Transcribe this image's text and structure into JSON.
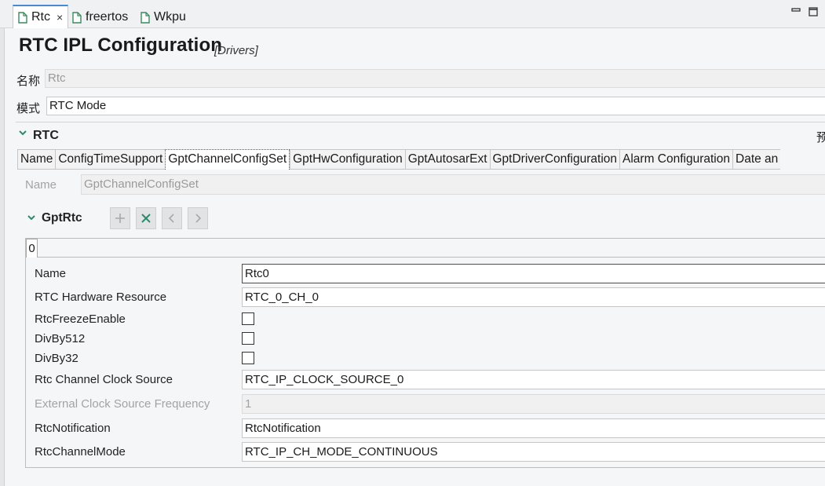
{
  "editor_tabs": [
    {
      "label": "Rtc",
      "close": "×"
    },
    {
      "label": "freertos"
    },
    {
      "label": "Wkpu"
    }
  ],
  "header": {
    "title": "RTC IPL Configuration",
    "subtitle": "[Drivers]"
  },
  "fields": {
    "name_label": "名称",
    "name_value": "Rtc",
    "mode_label": "模式",
    "mode_value": "RTC Mode"
  },
  "section": {
    "title": "RTC",
    "right_text": "预"
  },
  "tabs": [
    {
      "label": "Name"
    },
    {
      "label": "ConfigTimeSupport"
    },
    {
      "label": "GptChannelConfigSet"
    },
    {
      "label": "GptHwConfiguration"
    },
    {
      "label": "GptAutosarExt"
    },
    {
      "label": "GptDriverConfiguration"
    },
    {
      "label": "Alarm Configuration"
    },
    {
      "label": "Date an"
    }
  ],
  "channel_set": {
    "name_label": "Name",
    "name_value": "GptChannelConfigSet"
  },
  "subsection": {
    "title": "GptRtc",
    "index_tab": "0"
  },
  "properties": {
    "name": {
      "label": "Name",
      "value": "Rtc0"
    },
    "hw_resource": {
      "label": "RTC Hardware Resource",
      "value": "RTC_0_CH_0"
    },
    "freeze": {
      "label": "RtcFreezeEnable"
    },
    "div512": {
      "label": "DivBy512"
    },
    "div32": {
      "label": "DivBy32"
    },
    "clock_source": {
      "label": "Rtc Channel Clock Source",
      "value": "RTC_IP_CLOCK_SOURCE_0"
    },
    "ext_freq": {
      "label": "External Clock Source Frequency",
      "value": "1"
    },
    "notification": {
      "label": "RtcNotification",
      "value": "RtcNotification"
    },
    "channel_mode": {
      "label": "RtcChannelMode",
      "value": "RTC_IP_CH_MODE_CONTINUOUS"
    }
  },
  "colors": {
    "accent_green": "#2d8a6e",
    "active_tab_top": "#4a8ad4"
  }
}
